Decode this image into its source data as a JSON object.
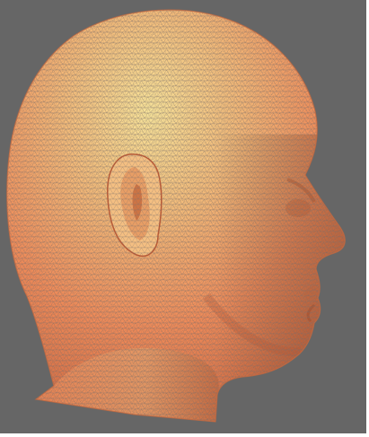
{
  "viewport": {
    "background_color": "#666666",
    "mesh_base_color": "#f08a58",
    "mesh_highlight_color": "#f7e08a",
    "mesh_shadow_color": "#b85a36",
    "wire_color": "#7a6f6a",
    "model_icon": "head-mesh-icon"
  }
}
